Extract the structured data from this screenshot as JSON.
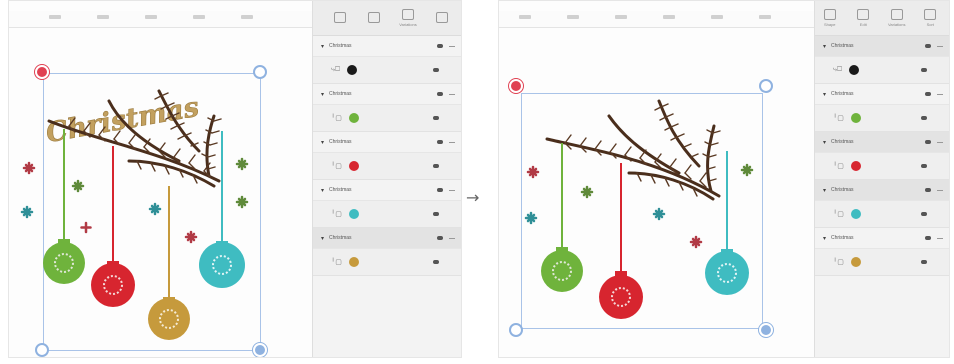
{
  "transition_arrow": "→",
  "left_panel": {
    "toolbar": [
      "",
      "",
      "Variations",
      ""
    ],
    "dimension_width": "",
    "dimension_height": "",
    "artwork_text": "Christmas",
    "layer_groups": [
      {
        "name": "Christmas",
        "chip_color": "#1a1a1a"
      },
      {
        "name": "Christmas",
        "chip_color": "#6fb33c"
      },
      {
        "name": "Christmas",
        "chip_color": "#d7252f"
      },
      {
        "name": "Christmas",
        "chip_color": "#3fbcc1"
      },
      {
        "name": "Christmas",
        "chip_color": "#c69a3c",
        "selected": true
      }
    ]
  },
  "right_panel": {
    "toolbar": [
      "Shape",
      "Edit",
      "Variations",
      "Sort"
    ],
    "dimension_width": "",
    "dimension_height": "",
    "layer_groups": [
      {
        "name": "Christmas",
        "chip_color": "#1a1a1a",
        "selected": true
      },
      {
        "name": "Christmas",
        "chip_color": "#6fb33c"
      },
      {
        "name": "Christmas",
        "chip_color": "#d7252f",
        "selected": true
      },
      {
        "name": "Christmas",
        "chip_color": "#3fbcc1",
        "selected": true
      },
      {
        "name": "Christmas",
        "chip_color": "#c69a3c"
      }
    ]
  },
  "colors": {
    "branch": "#4a2e1c",
    "ornament_green": "#6fb33c",
    "ornament_red": "#d7252f",
    "ornament_gold": "#c69a3c",
    "ornament_teal": "#3fbcc1",
    "star_red": "#b13a45",
    "star_teal": "#2f8f97",
    "star_green": "#5f8a3a",
    "script_gold": "#c2a05f",
    "selection": "#a9c3e8",
    "delete_handle": "#e04152"
  },
  "icons": [
    "delete-handle-icon",
    "rotate-handle-icon",
    "lock-handle-icon",
    "resize-handle-icon",
    "eye-icon",
    "chevron-down-icon",
    "arrow-right-icon"
  ]
}
